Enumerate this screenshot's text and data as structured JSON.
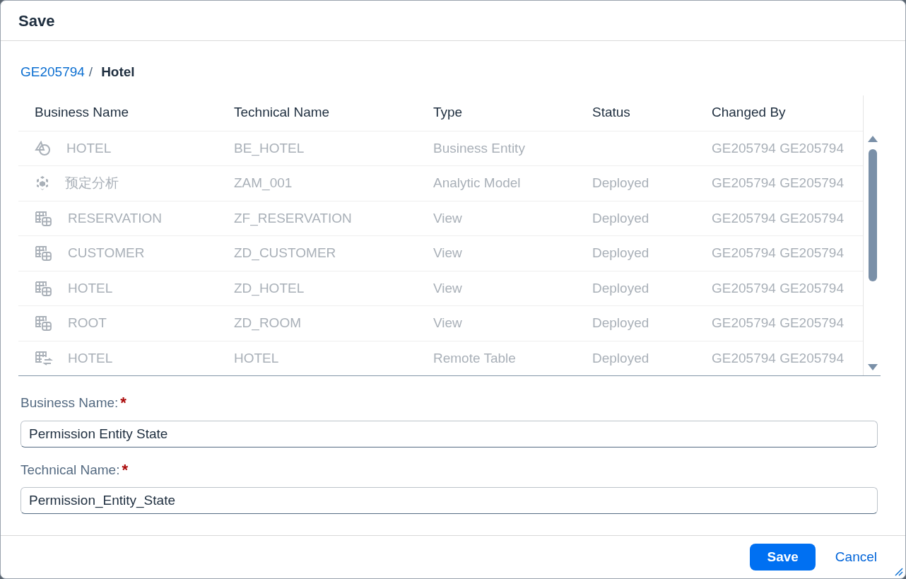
{
  "dialog": {
    "title": "Save"
  },
  "breadcrumb": {
    "link": "GE205794",
    "separator": "/",
    "current": "Hotel"
  },
  "table": {
    "columns": [
      "Business Name",
      "Technical Name",
      "Type",
      "Status",
      "Changed By"
    ],
    "rows": [
      {
        "kind": "entity",
        "disabled": true,
        "cells": [
          "HOTEL",
          "BE_HOTEL",
          "Business Entity",
          "",
          "GE205794 GE205794"
        ]
      },
      {
        "kind": "analytic",
        "disabled": true,
        "cells": [
          "预定分析",
          "ZAM_001",
          "Analytic Model",
          "Deployed",
          "GE205794 GE205794"
        ]
      },
      {
        "kind": "view",
        "disabled": true,
        "cells": [
          "RESERVATION",
          "ZF_RESERVATION",
          "View",
          "Deployed",
          "GE205794 GE205794"
        ]
      },
      {
        "kind": "view",
        "disabled": true,
        "cells": [
          "CUSTOMER",
          "ZD_CUSTOMER",
          "View",
          "Deployed",
          "GE205794 GE205794"
        ]
      },
      {
        "kind": "view",
        "disabled": true,
        "cells": [
          "HOTEL",
          "ZD_HOTEL",
          "View",
          "Deployed",
          "GE205794 GE205794"
        ]
      },
      {
        "kind": "view",
        "disabled": true,
        "cells": [
          "ROOT",
          "ZD_ROOM",
          "View",
          "Deployed",
          "GE205794 GE205794"
        ]
      },
      {
        "kind": "remote",
        "disabled": true,
        "cells": [
          "HOTEL",
          "HOTEL",
          "Remote Table",
          "Deployed",
          "GE205794 GE205794"
        ]
      }
    ]
  },
  "form": [
    {
      "label": "Business Name:",
      "required_mark": "*",
      "value": "Permission Entity State"
    },
    {
      "label": "Technical Name:",
      "required_mark": "*",
      "value": "Permission_Entity_State"
    }
  ],
  "footer": {
    "primary": "Save",
    "secondary": "Cancel"
  }
}
